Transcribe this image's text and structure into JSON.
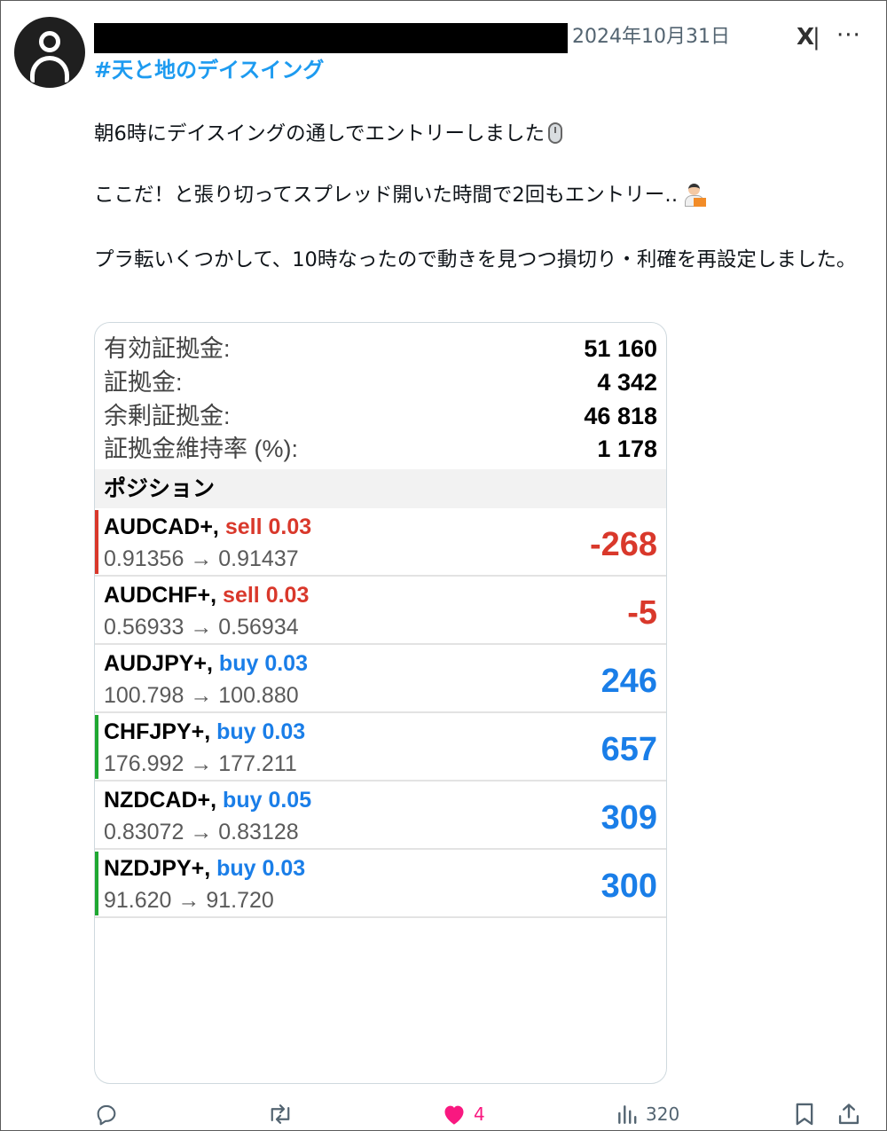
{
  "post": {
    "date": "2024年10月31日",
    "logo_text": "X",
    "more_label": "···",
    "hashtag": "#天と地のデイスイング",
    "paragraphs": [
      "朝6時にデイスイングの通しでエントリーしました",
      "ここだ！と張り切ってスプレッド開いた時間で2回もエントリー‥",
      "プラ転いくつかして、10時なったので動きを見つつ損切り・利確を再設定しました。"
    ],
    "icons": {
      "avatar": "default-avatar-icon",
      "p1_emoji": "computer-mouse-icon",
      "p2_emoji": "technologist-icon"
    }
  },
  "account_summary": [
    {
      "label": "有効証拠金:",
      "value": "51 160"
    },
    {
      "label": "証拠金:",
      "value": "4 342"
    },
    {
      "label": "余剰証拠金:",
      "value": "46 818"
    },
    {
      "label": "証拠金維持率 (%):",
      "value": "1 178"
    }
  ],
  "positions_header": "ポジション",
  "positions": [
    {
      "symbol": "AUDCAD+,",
      "side": "sell 0.03",
      "prices": "0.91356 → 0.91437",
      "profit": "-268",
      "profit_color": "#d9382b",
      "side_color": "#d9382b",
      "indicator": "#d9382b"
    },
    {
      "symbol": "AUDCHF+,",
      "side": "sell 0.03",
      "prices": "0.56933 → 0.56934",
      "profit": "-5",
      "profit_color": "#d9382b",
      "side_color": "#d9382b",
      "indicator": ""
    },
    {
      "symbol": "AUDJPY+,",
      "side": "buy 0.03",
      "prices": "100.798 → 100.880",
      "profit": "246",
      "profit_color": "#1a7ee8",
      "side_color": "#1a7ee8",
      "indicator": ""
    },
    {
      "symbol": "CHFJPY+,",
      "side": "buy 0.03",
      "prices": "176.992 → 177.211",
      "profit": "657",
      "profit_color": "#1a7ee8",
      "side_color": "#1a7ee8",
      "indicator": "#1fa831"
    },
    {
      "symbol": "NZDCAD+,",
      "side": "buy 0.05",
      "prices": "0.83072 → 0.83128",
      "profit": "309",
      "profit_color": "#1a7ee8",
      "side_color": "#1a7ee8",
      "indicator": ""
    },
    {
      "symbol": "NZDJPY+,",
      "side": "buy 0.03",
      "prices": "91.620 → 91.720",
      "profit": "300",
      "profit_color": "#1a7ee8",
      "side_color": "#1a7ee8",
      "indicator": "#1fa831"
    }
  ],
  "actions": {
    "reply_icon": "reply-icon",
    "retweet_icon": "retweet-icon",
    "like_icon": "heart-icon",
    "like_count": "4",
    "views_icon": "views-chart-icon",
    "views_count": "320",
    "bookmark_icon": "bookmark-icon",
    "share_icon": "share-icon",
    "like_color": "#f91880"
  }
}
